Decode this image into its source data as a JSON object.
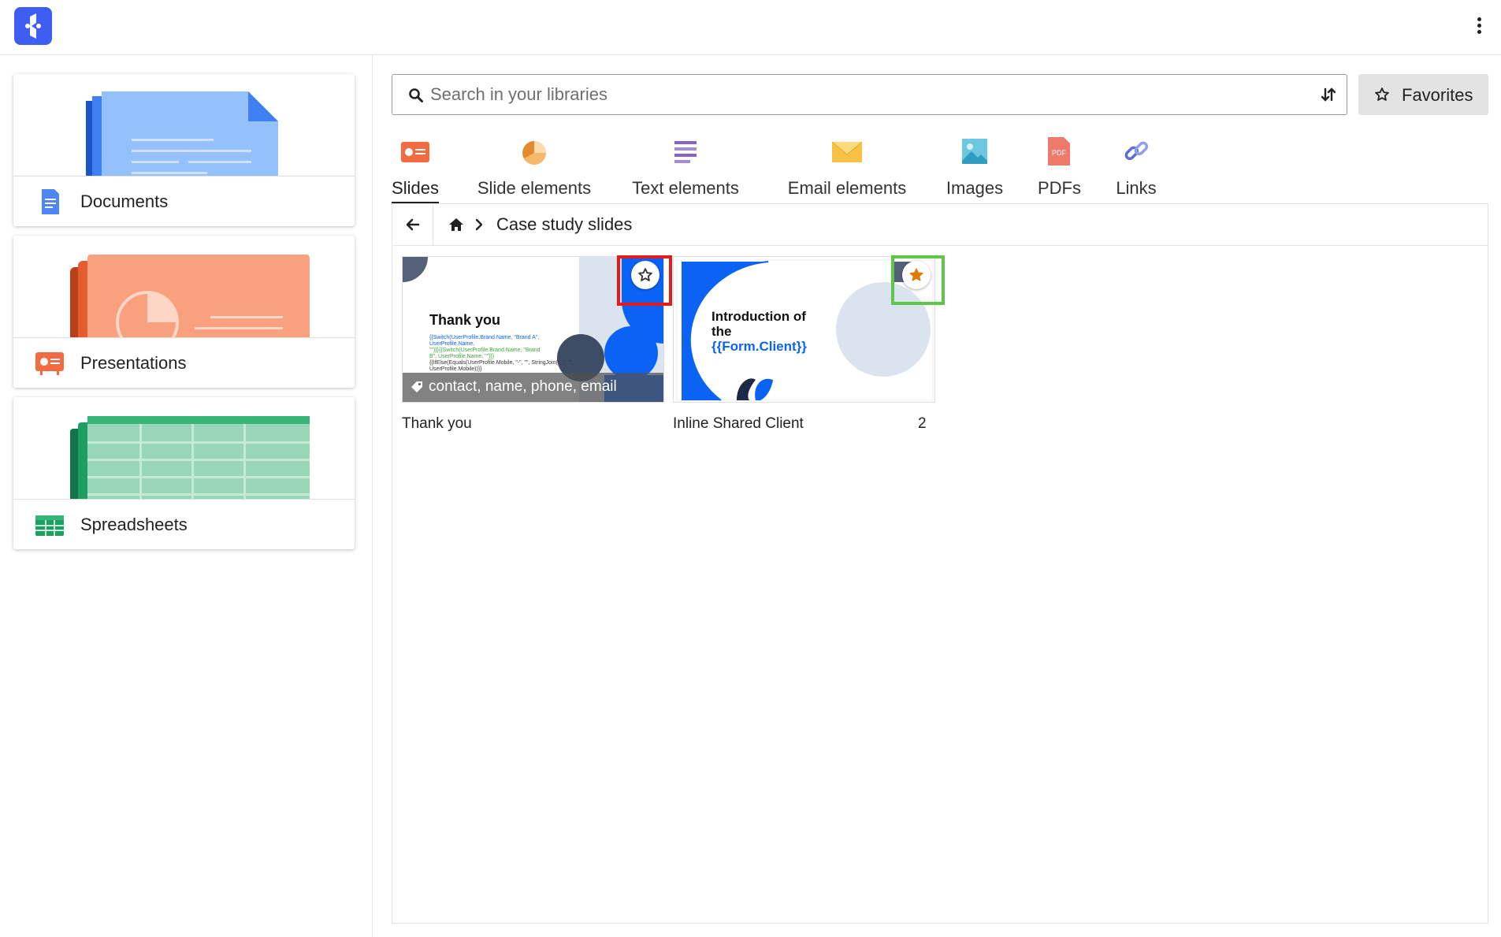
{
  "app": {
    "logo_icon": "app-logo-icon",
    "menu_icon": "kebab-menu-icon"
  },
  "sidebar": {
    "libraries": [
      {
        "label": "Documents",
        "icon": "document-icon",
        "color": "#4f86f7"
      },
      {
        "label": "Presentations",
        "icon": "presentation-icon",
        "color": "#f26b43"
      },
      {
        "label": "Spreadsheets",
        "icon": "spreadsheet-icon",
        "color": "#1e9e60"
      }
    ]
  },
  "search": {
    "placeholder": "Search in your libraries",
    "value": "",
    "filter_icon": "sort-filter-icon"
  },
  "favorites": {
    "label": "Favorites",
    "icon": "star-outline-icon"
  },
  "tabs": [
    {
      "label": "Slides",
      "icon": "slide-icon",
      "active": true
    },
    {
      "label": "Slide elements",
      "icon": "pie-chart-icon",
      "active": false
    },
    {
      "label": "Text elements",
      "icon": "text-lines-icon",
      "active": false
    },
    {
      "label": "Email elements",
      "icon": "envelope-icon",
      "active": false
    },
    {
      "label": "Images",
      "icon": "image-icon",
      "active": false
    },
    {
      "label": "PDFs",
      "icon": "pdf-icon",
      "active": false
    },
    {
      "label": "Links",
      "icon": "link-icon",
      "active": false
    }
  ],
  "breadcrumb": {
    "back_icon": "arrow-left-icon",
    "home_icon": "home-icon",
    "separator_icon": "chevron-right-icon",
    "current": "Case study slides"
  },
  "items": [
    {
      "name": "Thank you",
      "tags": "contact, name, phone, email",
      "favorited": false,
      "count": "",
      "thumb": {
        "title": "Thank you",
        "line1": "{{Switch(UserProfile.Brand.Name, \"Brand A\",",
        "line2": "UserProfile.Name,",
        "line3": "\"\")}}{{Switch(UserProfile.Brand.Name, \"Brand",
        "line4": "B\", UserProfile.Name, \"\")}}",
        "line5": "{{IfElse(Equals(UserProfile.Mobile, \"-\", \"\", StringJoin(\", \", \"\",",
        "line6": "UserProfile.Mobile))}}"
      }
    },
    {
      "name": "Inline Shared Client",
      "tags": "",
      "favorited": true,
      "count": "2",
      "thumb": {
        "title_line1": "Introduction of",
        "title_line2": "the",
        "title_line3": "{{Form.Client}}"
      }
    }
  ],
  "colors": {
    "accent_blue": "#0b63f6",
    "star_filled": "#e07b00",
    "highlight_red": "#e41b1b",
    "highlight_green": "#5ec74a"
  }
}
